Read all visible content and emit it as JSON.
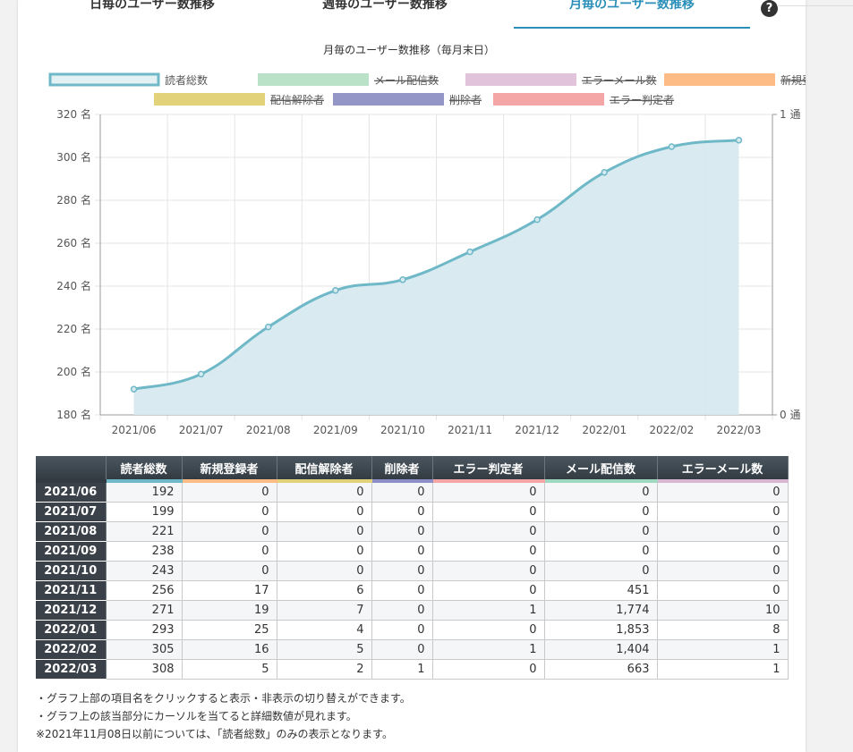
{
  "tabs": [
    {
      "label": "日毎のユーザー数推移",
      "active": false
    },
    {
      "label": "週毎のユーザー数推移",
      "active": false
    },
    {
      "label": "月毎のユーザー数推移",
      "active": true
    }
  ],
  "help_icon": "question-circle-icon",
  "colors": {
    "accent": "#2a8fb8",
    "total": "#6fb8c8",
    "mail": "#9fd8c0",
    "error_mail": "#d9b7d2",
    "new": "#fdb47a",
    "unsub": "#e0d07a",
    "deleted": "#8c8fc8",
    "error": "#f3a3a3"
  },
  "chart_data": {
    "type": "area",
    "title": "月毎のユーザー数推移（毎月末日）",
    "legend": [
      {
        "name": "読者総数",
        "hidden": false,
        "color": "#6fb8c8"
      },
      {
        "name": "メール配信数",
        "hidden": true,
        "color": "#b9e2c9"
      },
      {
        "name": "エラーメール数",
        "hidden": true,
        "color": "#e2c3dc"
      },
      {
        "name": "新規登録者",
        "hidden": true,
        "color": "#fdbb85"
      },
      {
        "name": "配信解除者",
        "hidden": true,
        "color": "#e2d37a"
      },
      {
        "name": "削除者",
        "hidden": true,
        "color": "#9496c8"
      },
      {
        "name": "エラー判定者",
        "hidden": true,
        "color": "#f4a6a6"
      }
    ],
    "categories": [
      "2021/06",
      "2021/07",
      "2021/08",
      "2021/09",
      "2021/10",
      "2021/11",
      "2021/12",
      "2022/01",
      "2022/02",
      "2022/03"
    ],
    "series": [
      {
        "name": "読者総数",
        "values": [
          192,
          199,
          221,
          238,
          243,
          256,
          271,
          293,
          305,
          308
        ]
      }
    ],
    "ylim": [
      180,
      320
    ],
    "yticks": [
      "180 名",
      "200 名",
      "220 名",
      "240 名",
      "260 名",
      "280 名",
      "300 名",
      "320 名"
    ],
    "y2ticks": [
      "0 通",
      "1 通"
    ],
    "legend_position": "top"
  },
  "table": {
    "headers": [
      "読者総数",
      "新規登録者",
      "配信解除者",
      "削除者",
      "エラー判定者",
      "メール配信数",
      "エラーメール数"
    ],
    "rows": [
      {
        "month": "2021/06",
        "cells": [
          "192",
          "0",
          "0",
          "0",
          "0",
          "0",
          "0"
        ]
      },
      {
        "month": "2021/07",
        "cells": [
          "199",
          "0",
          "0",
          "0",
          "0",
          "0",
          "0"
        ]
      },
      {
        "month": "2021/08",
        "cells": [
          "221",
          "0",
          "0",
          "0",
          "0",
          "0",
          "0"
        ]
      },
      {
        "month": "2021/09",
        "cells": [
          "238",
          "0",
          "0",
          "0",
          "0",
          "0",
          "0"
        ]
      },
      {
        "month": "2021/10",
        "cells": [
          "243",
          "0",
          "0",
          "0",
          "0",
          "0",
          "0"
        ]
      },
      {
        "month": "2021/11",
        "cells": [
          "256",
          "17",
          "6",
          "0",
          "0",
          "451",
          "0"
        ]
      },
      {
        "month": "2021/12",
        "cells": [
          "271",
          "19",
          "7",
          "0",
          "1",
          "1,774",
          "10"
        ]
      },
      {
        "month": "2022/01",
        "cells": [
          "293",
          "25",
          "4",
          "0",
          "0",
          "1,853",
          "8"
        ]
      },
      {
        "month": "2022/02",
        "cells": [
          "305",
          "16",
          "5",
          "0",
          "1",
          "1,404",
          "1"
        ]
      },
      {
        "month": "2022/03",
        "cells": [
          "308",
          "5",
          "2",
          "1",
          "0",
          "663",
          "1"
        ]
      }
    ]
  },
  "notes": [
    "・グラフ上部の項目名をクリックすると表示・非表示の切り替えができます。",
    "・グラフ上の該当部分にカーソルを当てると詳細数値が見れます。",
    "※2021年11月08日以前については、「読者総数」のみの表示となります。"
  ]
}
